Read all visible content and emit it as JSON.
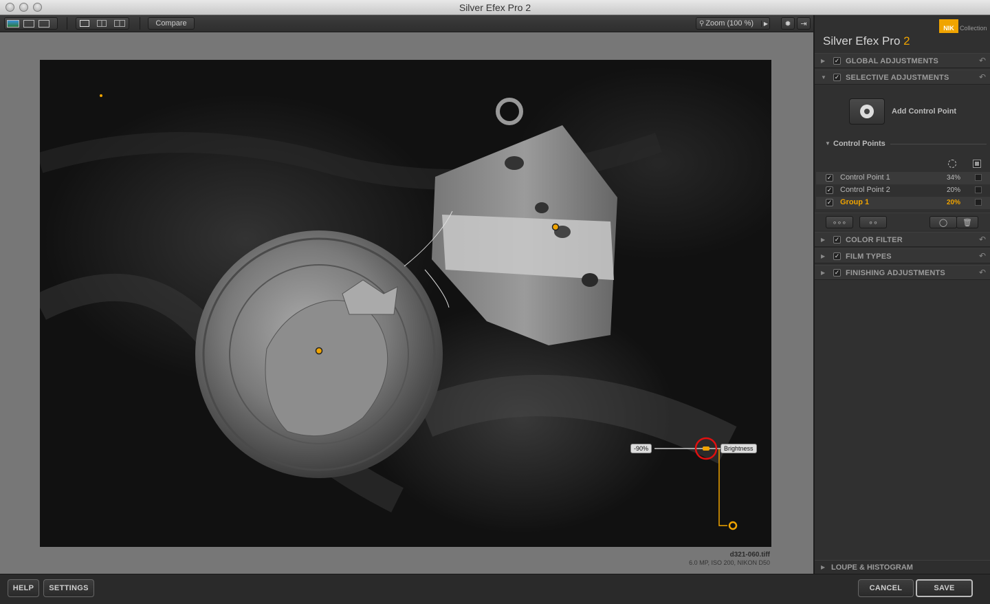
{
  "window": {
    "title": "Silver Efex Pro 2"
  },
  "toolbar": {
    "compare_label": "Compare",
    "zoom_label": "Zoom (100 %)"
  },
  "image": {
    "filename": "d321-060.tiff",
    "meta": "6.0 MP, ISO 200, NIKON D50",
    "slider": {
      "value_label": "-90%",
      "param_label": "Brightness"
    }
  },
  "panel": {
    "logo_text": "NIK",
    "logo_caption": "Collection",
    "brand_name": "Silver Efex Pro",
    "brand_version": "2",
    "sections": {
      "global": "GLOBAL ADJUSTMENTS",
      "selective": "SELECTIVE ADJUSTMENTS",
      "color_filter": "COLOR FILTER",
      "film_types": "FILM TYPES",
      "finishing": "FINISHING ADJUSTMENTS",
      "loupe": "LOUPE & HISTOGRAM"
    },
    "add_control_point": "Add Control Point",
    "control_points_header": "Control Points",
    "control_points": [
      {
        "name": "Control Point 1",
        "percent": "34%"
      },
      {
        "name": "Control Point 2",
        "percent": "20%"
      },
      {
        "name": "Group 1",
        "percent": "20%"
      }
    ]
  },
  "bottom": {
    "help": "HELP",
    "settings": "SETTINGS",
    "cancel": "CANCEL",
    "save": "SAVE"
  },
  "colors": {
    "accent": "#f0a400",
    "highlight_ring": "#e01010"
  }
}
